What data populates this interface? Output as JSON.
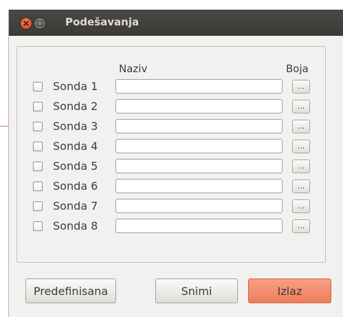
{
  "window": {
    "title": "Podešavanja"
  },
  "table": {
    "header_name": "Naziv",
    "header_color": "Boja",
    "rows": [
      {
        "label": "Sonda 1",
        "name_value": "",
        "color_button": "...",
        "checked": false
      },
      {
        "label": "Sonda 2",
        "name_value": "",
        "color_button": "...",
        "checked": false
      },
      {
        "label": "Sonda 3",
        "name_value": "",
        "color_button": "...",
        "checked": false
      },
      {
        "label": "Sonda 4",
        "name_value": "",
        "color_button": "...",
        "checked": false
      },
      {
        "label": "Sonda 5",
        "name_value": "",
        "color_button": "...",
        "checked": false
      },
      {
        "label": "Sonda 6",
        "name_value": "",
        "color_button": "...",
        "checked": false
      },
      {
        "label": "Sonda 7",
        "name_value": "",
        "color_button": "...",
        "checked": false
      },
      {
        "label": "Sonda 8",
        "name_value": "",
        "color_button": "...",
        "checked": false
      }
    ]
  },
  "buttons": {
    "predefined": "Predefinisana",
    "save": "Snimi",
    "exit": "Izlaz"
  },
  "colors": {
    "titlebar": "#3c3b37",
    "window_bg": "#f2f1f0",
    "accent_exit": "#ef7d5c"
  },
  "icons": {
    "close": "close-icon",
    "maximize": "maximize-icon"
  }
}
